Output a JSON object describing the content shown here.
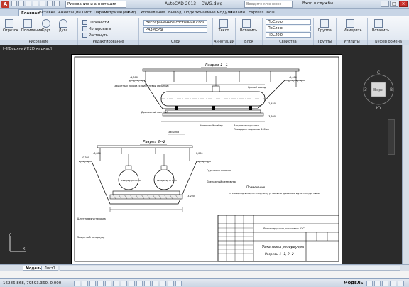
{
  "titlebar": {
    "workspace": "Рисование и аннотация",
    "app_title": "AutoCAD 2013",
    "document": "DWG.dwg",
    "search_placeholder": "Введите ключевое слово/фразу",
    "signin": "Вход в службы"
  },
  "tabs": [
    "Главная",
    "Вставка",
    "Аннотации",
    "Лист",
    "Параметризация",
    "Вид",
    "Управление",
    "Вывод",
    "Подключаемые модули",
    "Онлайн",
    "Express Tools"
  ],
  "ribbon": {
    "draw": {
      "label": "Рисование",
      "buttons": [
        "Отрезок",
        "Полилиния",
        "Круг",
        "Дуга"
      ]
    },
    "modify": {
      "label": "Редактирование",
      "items": [
        "Перенести",
        "Копировать",
        "Растянуть"
      ]
    },
    "layers": {
      "label": "Слои",
      "items": [
        "Несохраненное состояние слоя",
        "РАЗМЕРЫ"
      ]
    },
    "annotation": {
      "label": "Аннотации",
      "buttons": [
        "Текст"
      ]
    },
    "block": {
      "label": "Блок",
      "buttons": [
        "Вставить"
      ]
    },
    "properties": {
      "label": "Свойства",
      "items": [
        "ПоСлою",
        "ПоСлою",
        "ПоСлою"
      ]
    },
    "groups": {
      "label": "Группы",
      "buttons": [
        "Группа"
      ]
    },
    "utilities": {
      "label": "Утилиты",
      "buttons": [
        "Измерить"
      ]
    },
    "clipboard": {
      "label": "Буфер обмена",
      "buttons": [
        "Вставить"
      ]
    }
  },
  "viewport": {
    "label": "[-][Верхний][2D каркас]"
  },
  "viewcube": {
    "north": "С",
    "south": "Ю",
    "west": "З",
    "east": "В",
    "top": "Верх"
  },
  "drawing": {
    "section1": "Разрез 1--1",
    "section2": "Разрез 2--2",
    "note_title": "Примечание",
    "note_line": "1. Ранец подсыпки/3% и подсыпку установить дренажное в/участок грунтовые",
    "stamp_title": "Установка резервуара",
    "stamp_sub": "Разрезы 1--1, 2--2",
    "stamp_work": "Реконструкция установки АЗС",
    "labels_1": [
      "Защитный покров (слой полевой обсыпки)",
      "Кривой выход",
      "Кнопочный шабер",
      "Вакумная подсыпка",
      "Площадка подсыпки 200мм",
      "Дренажный пол Н=0"
    ],
    "labels_2": [
      "Засыпка",
      "Грунтовая засыпка",
      "Резервуар РГС-40",
      "Дренажный резервуар",
      "Шпунтовая установка",
      "Защитный резервуар"
    ],
    "elev": [
      "-1,500",
      "-2,000",
      "-2,450",
      "-3,500",
      "-3,800",
      "+0,000",
      "-3,200",
      "-0,300"
    ]
  },
  "layout_tabs": [
    "Модель",
    "Лист1"
  ],
  "status": {
    "coords": "16286.868, 79593.360, 0.000",
    "model": "МОДЕЛЬ"
  }
}
